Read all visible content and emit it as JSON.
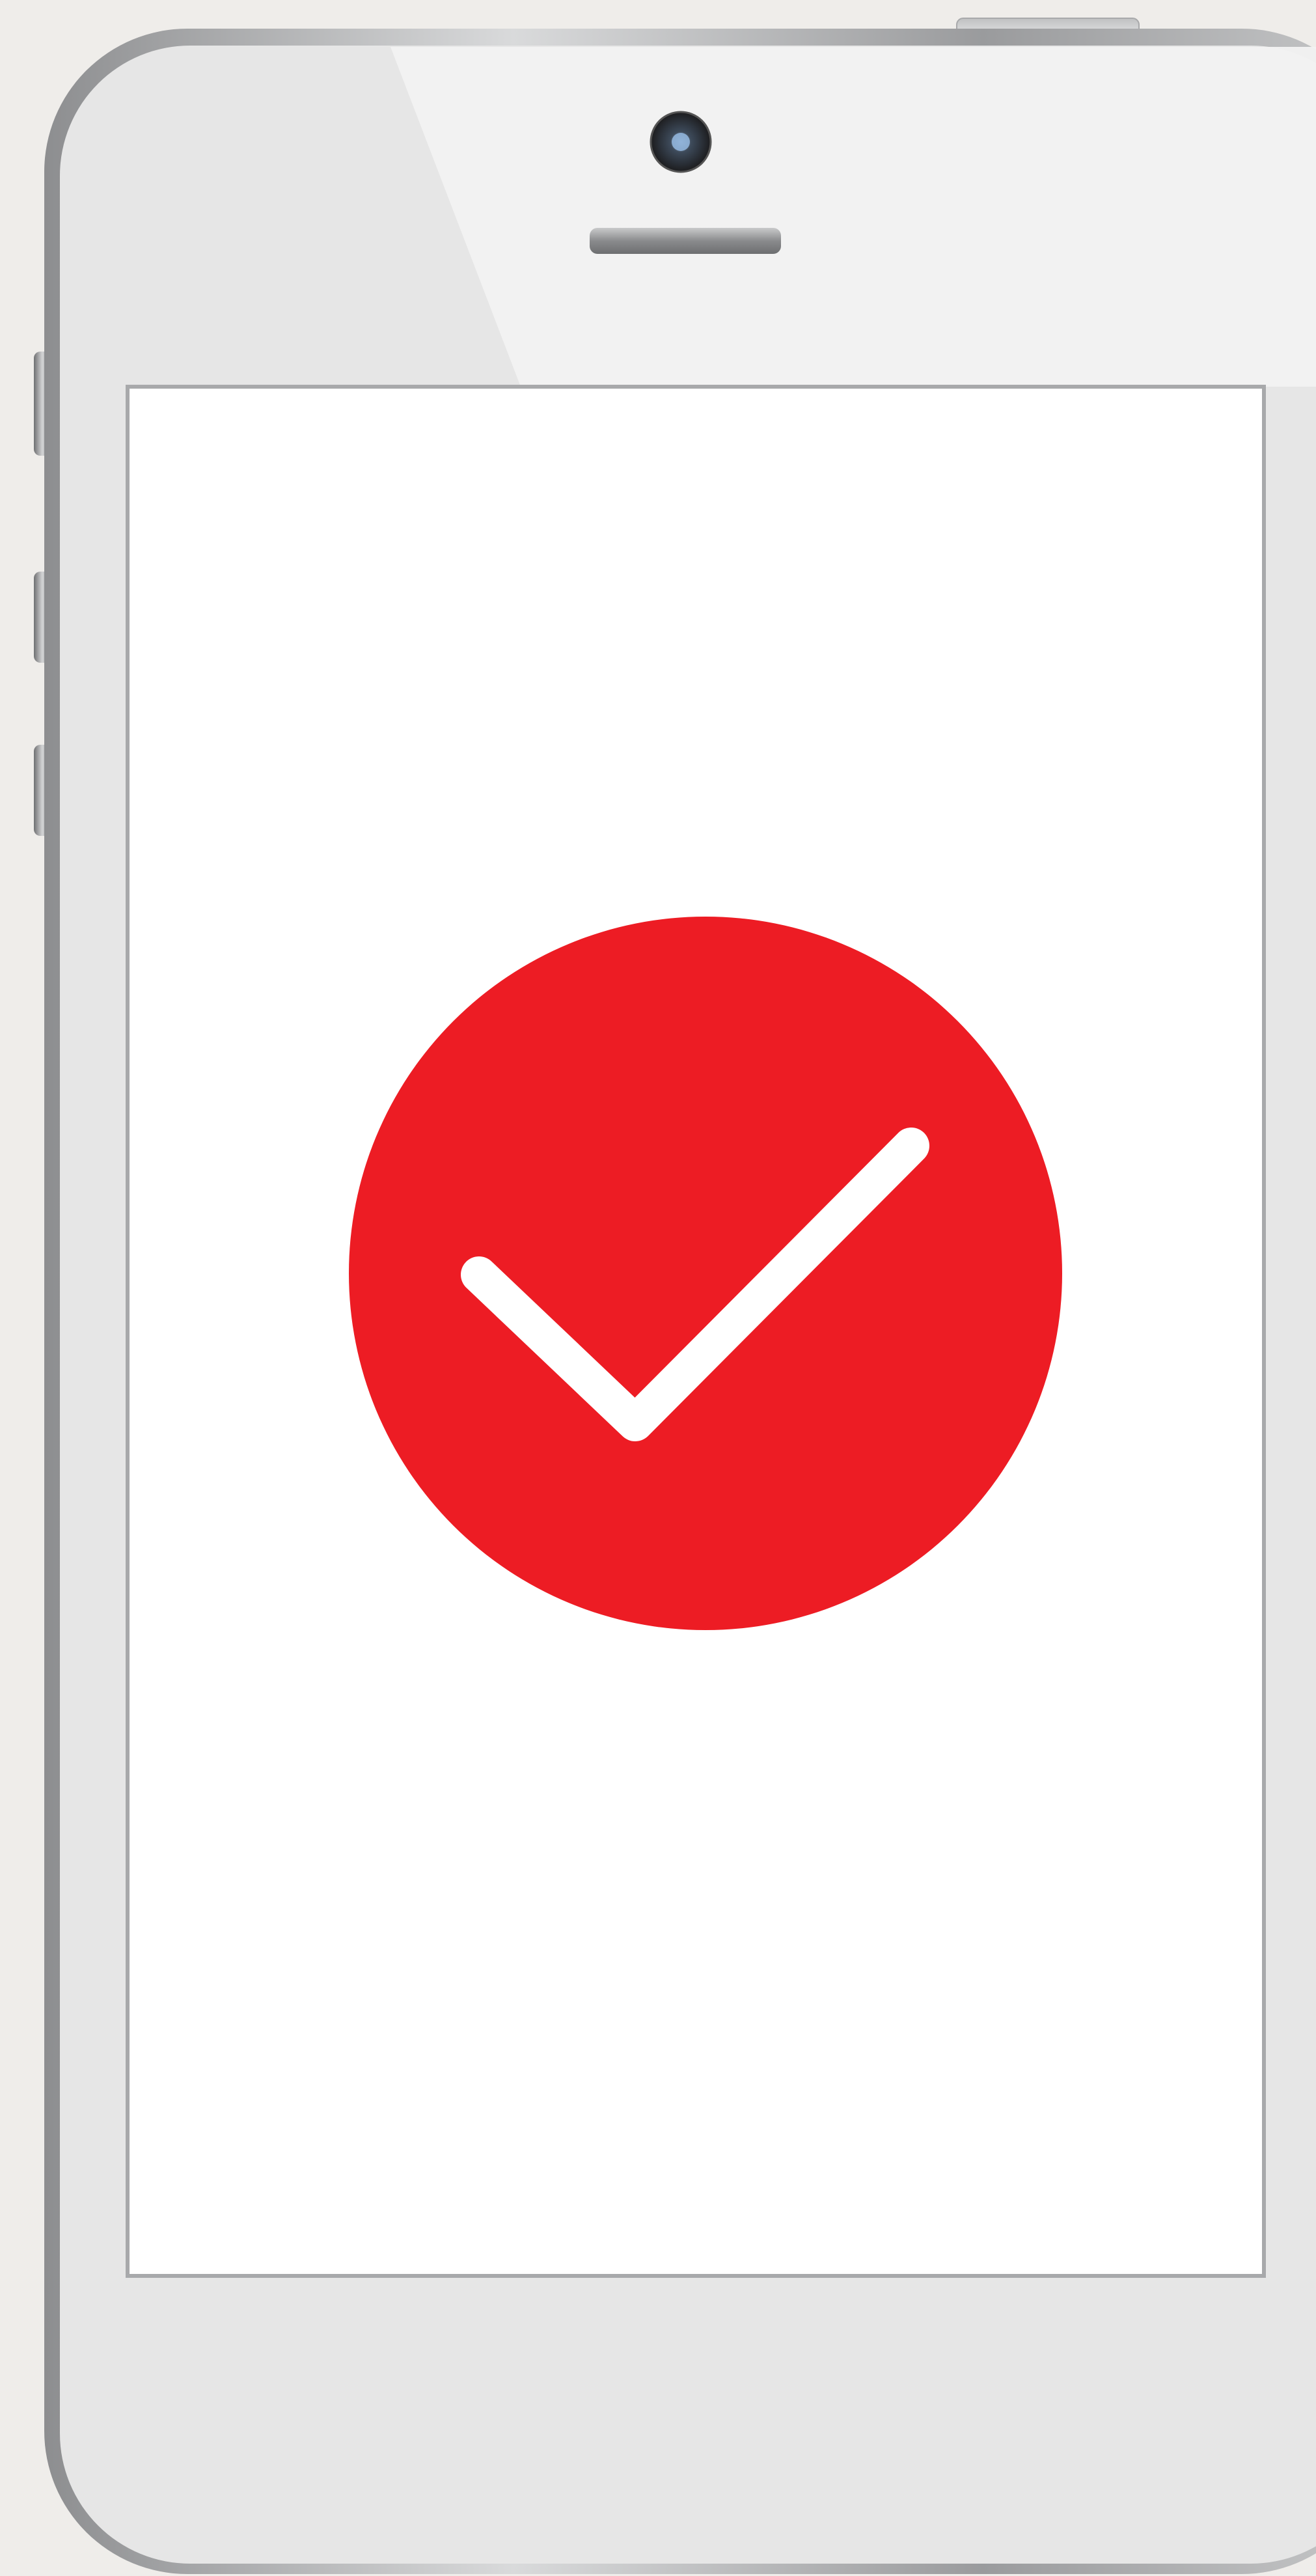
{
  "scene": {
    "background_color": "#efedea",
    "device": {
      "type": "smartphone",
      "body_color": "#e6e6e6",
      "frame_color": "#a8a9ab",
      "screen_color": "#ffffff",
      "screen_border_color": "#a8a9ab"
    },
    "screen": {
      "icon": "checkmark-circle-icon",
      "icon_color": "#ed1c24",
      "check_color": "#ffffff"
    }
  }
}
